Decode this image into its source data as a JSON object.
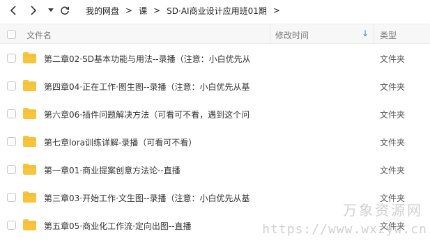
{
  "breadcrumb": {
    "items": [
      "我的网盘",
      "课",
      "SD·AI商业设计应用班01期"
    ],
    "separator": ">",
    "trailing": ">"
  },
  "columns": {
    "name": "文件名",
    "modified": "修改时间",
    "type": "类型"
  },
  "files": [
    {
      "name": "第二章02·SD基本功能与用法--录播（注意：小白优先从",
      "type": "文件夹"
    },
    {
      "name": "第四章04·正在工作·图生图--录播（注意：小白优先从基",
      "type": "文件夹"
    },
    {
      "name": "第六章06·插件问题解决方法（可看可不看，遇到这个问",
      "type": "文件夹"
    },
    {
      "name": "第七章lora训练详解-录播（可看可不看）",
      "type": "文件夹"
    },
    {
      "name": "第一章01·商业提案创意方法论--直播",
      "type": "文件夹"
    },
    {
      "name": "第三章03·开始工作·文生图--录播（注意：小白优先从基",
      "type": "文件夹"
    },
    {
      "name": "第五章05·商业化工作流·定向出图--直播",
      "type": "文件夹"
    }
  ],
  "watermark": {
    "line1": "万象资源网",
    "line2": "https://www.wxzyw.cn"
  },
  "colors": {
    "folder": "#f7c53d",
    "sort_arrow": "#1e88e5",
    "header_bg": "#f7f7f8"
  }
}
